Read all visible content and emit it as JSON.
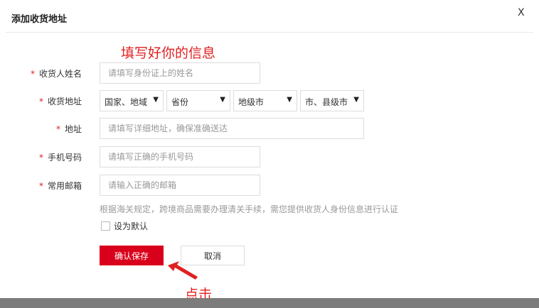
{
  "dialog": {
    "title": "添加收货地址",
    "close_label": "X"
  },
  "annotations": {
    "top_hint": "填写好你的信息",
    "bottom_hint": "点击",
    "color": "#e02020"
  },
  "form": {
    "required_mark": "*",
    "name": {
      "label": "收货人姓名",
      "placeholder": "请填写身份证上的姓名",
      "value": ""
    },
    "region": {
      "label": "收货地址",
      "country": "国家、地域",
      "province": "省份",
      "city": "地级市",
      "district": "市、县级市"
    },
    "address": {
      "label": "地址",
      "placeholder": "请填写详细地址，确保准确送达",
      "value": ""
    },
    "phone": {
      "label": "手机号码",
      "placeholder": "请填写正确的手机号码",
      "value": ""
    },
    "email": {
      "label": "常用邮箱",
      "placeholder": "请输入正确的邮箱",
      "value": ""
    },
    "notice": "根据海关规定，跨境商品需要办理清关手续，需您提供收货人身份信息进行认证",
    "default_label": "设为默认",
    "default_checked": false
  },
  "buttons": {
    "save_label": "确认保存",
    "cancel_label": "取消"
  },
  "colors": {
    "primary": "#d9001b",
    "border": "#dcdcdc",
    "placeholder": "#999999"
  },
  "icons": {
    "dropdown": "▼",
    "arrow_annotation": "red-arrow-pointing-up-left"
  }
}
